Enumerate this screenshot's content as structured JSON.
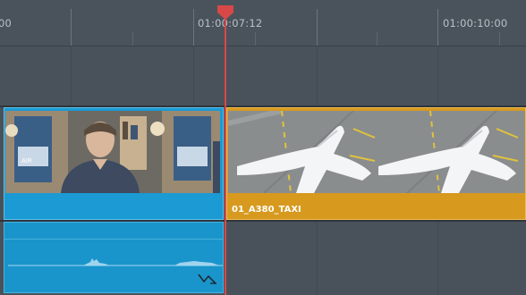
{
  "ruler": {
    "left_timecode": "00",
    "center_timecode": "01:00:07:12",
    "right_timecode": "01:00:10:00"
  },
  "video_track": {
    "clips": [
      {
        "name": "",
        "color": "#1b9ad3",
        "thumbnail": "interview-speaker-thumbnail"
      },
      {
        "name": "01_A380_TAXI",
        "color": "#d79a1f",
        "thumbnail": "a380-airplane-taxi-thumbnail"
      }
    ]
  },
  "audio_track": {
    "clips": [
      {
        "color": "#1a95cb",
        "icon": "volume-curve-icon"
      }
    ]
  },
  "playhead": {
    "color": "#d94848"
  },
  "colors": {
    "background": "#49525a",
    "ruler": "#4a535b"
  }
}
